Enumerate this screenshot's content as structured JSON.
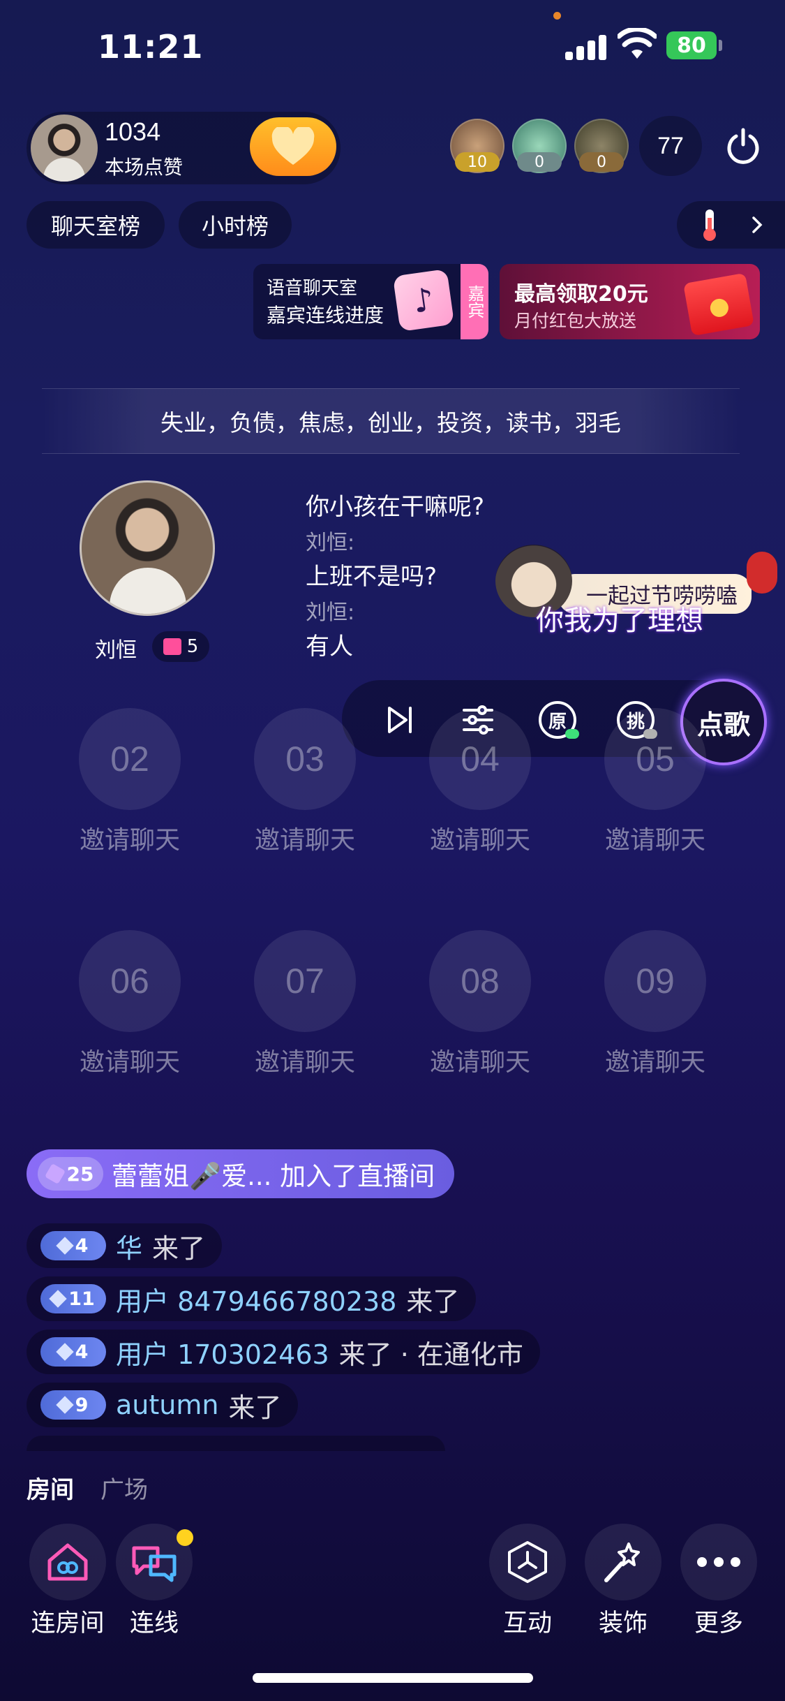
{
  "status_bar": {
    "time": "11:21",
    "battery": "80"
  },
  "host": {
    "likes": "1034",
    "likes_label": "本场点赞"
  },
  "viewers": {
    "badges": [
      "10",
      "0",
      "0"
    ],
    "count": "77"
  },
  "rank_tabs": [
    "聊天室榜",
    "小时榜"
  ],
  "banners": {
    "voice_title": "语音聊天室",
    "voice_sub": "嘉宾连线进度",
    "jiabin_tag": "嘉宾",
    "red_title": "最高领取20元",
    "red_sub": "月付红包大放送"
  },
  "topic": "失业，负债，焦虑，创业，投资，读书，羽毛",
  "speaker": {
    "name": "刘恒",
    "gift_count": "5"
  },
  "lyrics": [
    {
      "text": "你小孩在干嘛呢?"
    },
    {
      "name": "刘恒:"
    },
    {
      "text": "上班不是吗?"
    },
    {
      "name": "刘恒:"
    },
    {
      "text": "有人"
    }
  ],
  "song": {
    "overlay_title": "一起过节唠唠嗑",
    "current_line": "你我为了理想"
  },
  "song_controls": {
    "original": "原",
    "pick": "挑",
    "request": "点歌"
  },
  "seats": [
    {
      "num": "02",
      "label": "邀请聊天"
    },
    {
      "num": "03",
      "label": "邀请聊天"
    },
    {
      "num": "04",
      "label": "邀请聊天"
    },
    {
      "num": "05",
      "label": "邀请聊天"
    },
    {
      "num": "06",
      "label": "邀请聊天"
    },
    {
      "num": "07",
      "label": "邀请聊天"
    },
    {
      "num": "08",
      "label": "邀请聊天"
    },
    {
      "num": "09",
      "label": "邀请聊天"
    }
  ],
  "join_message": {
    "level": "25",
    "text": "蕾蕾姐🎤爱... 加入了直播间"
  },
  "chat": [
    {
      "level": "4",
      "user": "华",
      "msg": "来了"
    },
    {
      "level": "11",
      "user": "用户 8479466780238",
      "msg": "来了"
    },
    {
      "level": "4",
      "user": "用户 170302463",
      "msg": "来了 · 在通化市"
    },
    {
      "level": "9",
      "user": "autumn",
      "msg": "来了"
    }
  ],
  "bottom_tabs": {
    "room": "房间",
    "plaza": "广场"
  },
  "bottom_actions": {
    "connect_room": "连房间",
    "connect": "连线",
    "interact": "互动",
    "decorate": "装饰",
    "more": "更多"
  }
}
